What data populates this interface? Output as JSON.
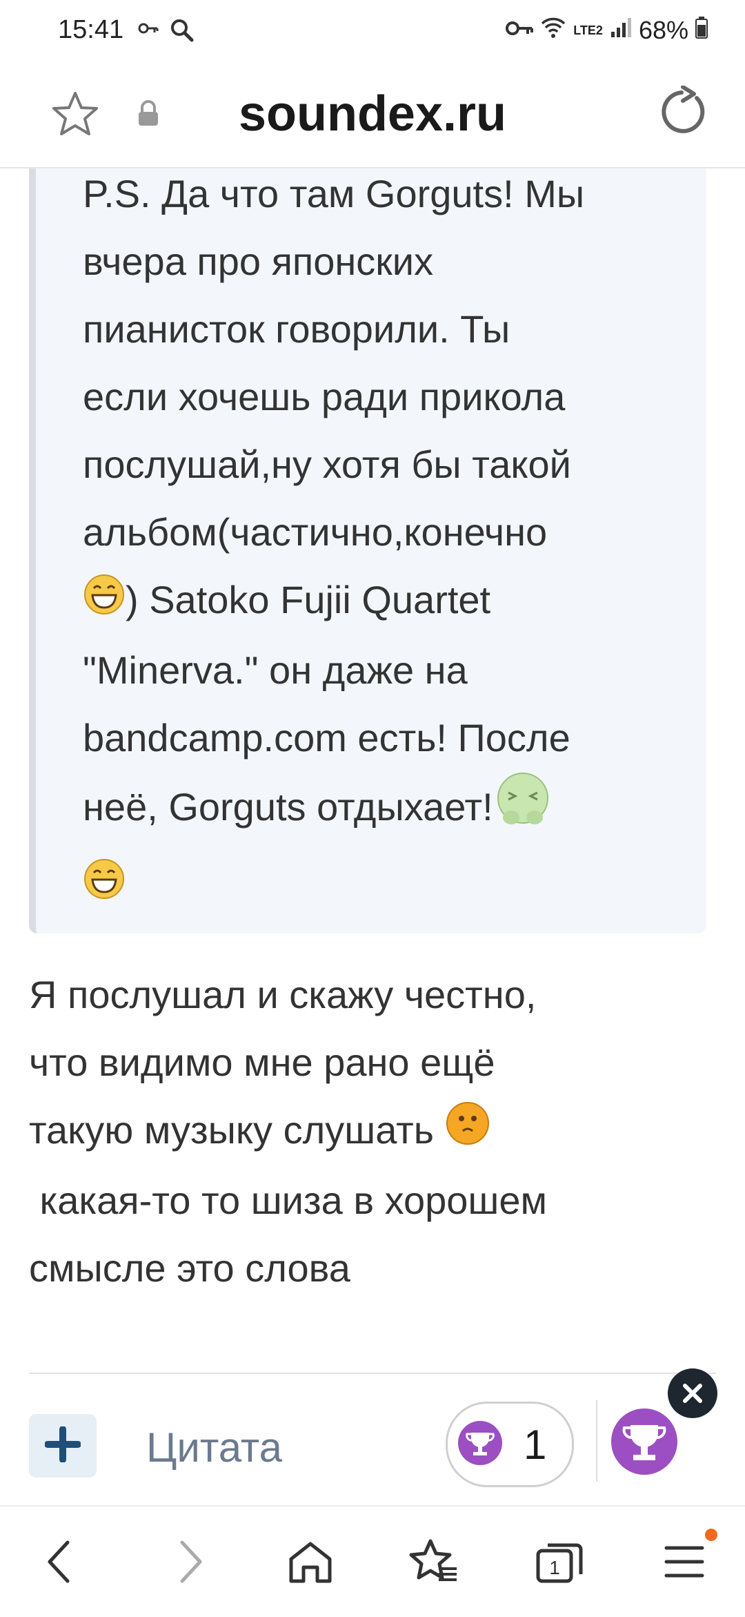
{
  "status_bar": {
    "time": "15:41",
    "battery": "68%",
    "network": "LTE2"
  },
  "address_bar": {
    "domain": "soundex.ru"
  },
  "post": {
    "quote_lines": [
      "P.S. Да что там Gorguts! Мы",
      "вчера про японских",
      "пианисток говорили. Ты",
      "если хочешь ради прикола",
      "послушай,ну хотя бы такой",
      "альбом(частично,конечно",
      ") Satoko Fujii Quartet",
      "\"Minerva.\" он даже на",
      "bandcamp.com есть! После",
      "неё, Gorguts отдыхает!"
    ],
    "reply_lines": [
      "Я послушал и скажу честно,",
      "что видимо мне рано ещё",
      "такую музыку слушать",
      " какая-то то шиза в хорошем",
      "смысле это слова"
    ]
  },
  "actions": {
    "quote_label": "Цитата",
    "likes_count": "1"
  },
  "colors": {
    "quote_bg": "#f3f7fb",
    "accent_purple": "#9b4fc2",
    "notification_dot": "#f06a1d"
  },
  "icons": [
    "star-icon",
    "lock-icon",
    "reload-icon",
    "plus-icon",
    "trophy-icon",
    "close-icon",
    "back-icon",
    "forward-icon",
    "home-icon",
    "bookmarks-icon",
    "tabs-icon",
    "menu-icon"
  ]
}
